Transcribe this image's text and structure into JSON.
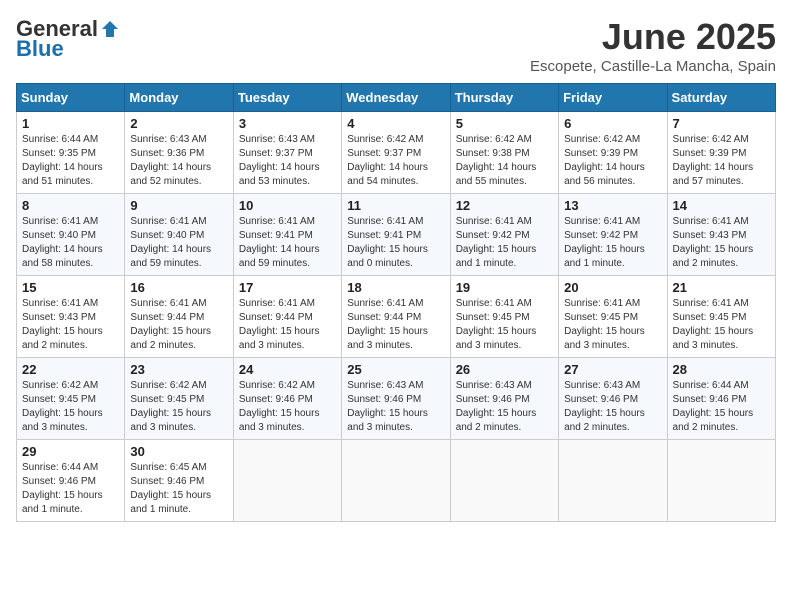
{
  "logo": {
    "general": "General",
    "blue": "Blue"
  },
  "title": "June 2025",
  "location": "Escopete, Castille-La Mancha, Spain",
  "days_of_week": [
    "Sunday",
    "Monday",
    "Tuesday",
    "Wednesday",
    "Thursday",
    "Friday",
    "Saturday"
  ],
  "weeks": [
    [
      {
        "day": "1",
        "info": "Sunrise: 6:44 AM\nSunset: 9:35 PM\nDaylight: 14 hours\nand 51 minutes."
      },
      {
        "day": "2",
        "info": "Sunrise: 6:43 AM\nSunset: 9:36 PM\nDaylight: 14 hours\nand 52 minutes."
      },
      {
        "day": "3",
        "info": "Sunrise: 6:43 AM\nSunset: 9:37 PM\nDaylight: 14 hours\nand 53 minutes."
      },
      {
        "day": "4",
        "info": "Sunrise: 6:42 AM\nSunset: 9:37 PM\nDaylight: 14 hours\nand 54 minutes."
      },
      {
        "day": "5",
        "info": "Sunrise: 6:42 AM\nSunset: 9:38 PM\nDaylight: 14 hours\nand 55 minutes."
      },
      {
        "day": "6",
        "info": "Sunrise: 6:42 AM\nSunset: 9:39 PM\nDaylight: 14 hours\nand 56 minutes."
      },
      {
        "day": "7",
        "info": "Sunrise: 6:42 AM\nSunset: 9:39 PM\nDaylight: 14 hours\nand 57 minutes."
      }
    ],
    [
      {
        "day": "8",
        "info": "Sunrise: 6:41 AM\nSunset: 9:40 PM\nDaylight: 14 hours\nand 58 minutes."
      },
      {
        "day": "9",
        "info": "Sunrise: 6:41 AM\nSunset: 9:40 PM\nDaylight: 14 hours\nand 59 minutes."
      },
      {
        "day": "10",
        "info": "Sunrise: 6:41 AM\nSunset: 9:41 PM\nDaylight: 14 hours\nand 59 minutes."
      },
      {
        "day": "11",
        "info": "Sunrise: 6:41 AM\nSunset: 9:41 PM\nDaylight: 15 hours\nand 0 minutes."
      },
      {
        "day": "12",
        "info": "Sunrise: 6:41 AM\nSunset: 9:42 PM\nDaylight: 15 hours\nand 1 minute."
      },
      {
        "day": "13",
        "info": "Sunrise: 6:41 AM\nSunset: 9:42 PM\nDaylight: 15 hours\nand 1 minute."
      },
      {
        "day": "14",
        "info": "Sunrise: 6:41 AM\nSunset: 9:43 PM\nDaylight: 15 hours\nand 2 minutes."
      }
    ],
    [
      {
        "day": "15",
        "info": "Sunrise: 6:41 AM\nSunset: 9:43 PM\nDaylight: 15 hours\nand 2 minutes."
      },
      {
        "day": "16",
        "info": "Sunrise: 6:41 AM\nSunset: 9:44 PM\nDaylight: 15 hours\nand 2 minutes."
      },
      {
        "day": "17",
        "info": "Sunrise: 6:41 AM\nSunset: 9:44 PM\nDaylight: 15 hours\nand 3 minutes."
      },
      {
        "day": "18",
        "info": "Sunrise: 6:41 AM\nSunset: 9:44 PM\nDaylight: 15 hours\nand 3 minutes."
      },
      {
        "day": "19",
        "info": "Sunrise: 6:41 AM\nSunset: 9:45 PM\nDaylight: 15 hours\nand 3 minutes."
      },
      {
        "day": "20",
        "info": "Sunrise: 6:41 AM\nSunset: 9:45 PM\nDaylight: 15 hours\nand 3 minutes."
      },
      {
        "day": "21",
        "info": "Sunrise: 6:41 AM\nSunset: 9:45 PM\nDaylight: 15 hours\nand 3 minutes."
      }
    ],
    [
      {
        "day": "22",
        "info": "Sunrise: 6:42 AM\nSunset: 9:45 PM\nDaylight: 15 hours\nand 3 minutes."
      },
      {
        "day": "23",
        "info": "Sunrise: 6:42 AM\nSunset: 9:45 PM\nDaylight: 15 hours\nand 3 minutes."
      },
      {
        "day": "24",
        "info": "Sunrise: 6:42 AM\nSunset: 9:46 PM\nDaylight: 15 hours\nand 3 minutes."
      },
      {
        "day": "25",
        "info": "Sunrise: 6:43 AM\nSunset: 9:46 PM\nDaylight: 15 hours\nand 3 minutes."
      },
      {
        "day": "26",
        "info": "Sunrise: 6:43 AM\nSunset: 9:46 PM\nDaylight: 15 hours\nand 2 minutes."
      },
      {
        "day": "27",
        "info": "Sunrise: 6:43 AM\nSunset: 9:46 PM\nDaylight: 15 hours\nand 2 minutes."
      },
      {
        "day": "28",
        "info": "Sunrise: 6:44 AM\nSunset: 9:46 PM\nDaylight: 15 hours\nand 2 minutes."
      }
    ],
    [
      {
        "day": "29",
        "info": "Sunrise: 6:44 AM\nSunset: 9:46 PM\nDaylight: 15 hours\nand 1 minute."
      },
      {
        "day": "30",
        "info": "Sunrise: 6:45 AM\nSunset: 9:46 PM\nDaylight: 15 hours\nand 1 minute."
      },
      {
        "day": "",
        "info": ""
      },
      {
        "day": "",
        "info": ""
      },
      {
        "day": "",
        "info": ""
      },
      {
        "day": "",
        "info": ""
      },
      {
        "day": "",
        "info": ""
      }
    ]
  ]
}
